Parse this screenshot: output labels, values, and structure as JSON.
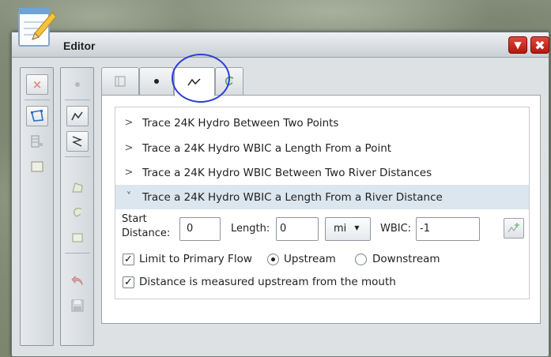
{
  "window": {
    "title": "Editor",
    "minimize_glyph": "▼",
    "close_glyph": "✖"
  },
  "icons": {
    "editor": "editor-pencil-icon",
    "toolbar1": [
      "delete-icon",
      "select-polygon-icon",
      "attribute-table-icon",
      "select-rect-icon"
    ],
    "toolbar2": [
      "point-icon",
      "trace-line-icon",
      "reshape-icon",
      "polygon-icon",
      "curve-icon",
      "vertex-icon",
      "undo-icon",
      "save-icon"
    ],
    "tabs": [
      "layer-tab-icon",
      "point-tab-icon",
      "line-tab-icon",
      "curve-tab-icon"
    ]
  },
  "colors": {
    "accent_circle": "#2b3fd6",
    "close_button": "#c8271f",
    "selected_row": "#dce6ee"
  },
  "trace_options": [
    {
      "chevron": ">",
      "label": "Trace 24K Hydro Between Two Points"
    },
    {
      "chevron": ">",
      "label": "Trace a 24K Hydro WBIC a Length From a Point"
    },
    {
      "chevron": ">",
      "label": "Trace a 24K Hydro WBIC Between Two River Distances"
    },
    {
      "chevron": "˅",
      "label": "Trace a 24K Hydro WBIC a Length From a River Distance"
    }
  ],
  "form": {
    "start_label_1": "Start",
    "start_label_2": "Distance:",
    "start_value": "0",
    "length_label": "Length:",
    "length_value": "0",
    "unit_value": "mi",
    "unit_arrow": "▼",
    "wbic_label": "WBIC:",
    "wbic_value": "-1",
    "limit_label": "Limit to Primary Flow",
    "limit_checked": "✓",
    "upstream_label": "Upstream",
    "downstream_label": "Downstream",
    "measured_label": "Distance is measured upstream from the mouth",
    "measured_checked": "✓"
  }
}
